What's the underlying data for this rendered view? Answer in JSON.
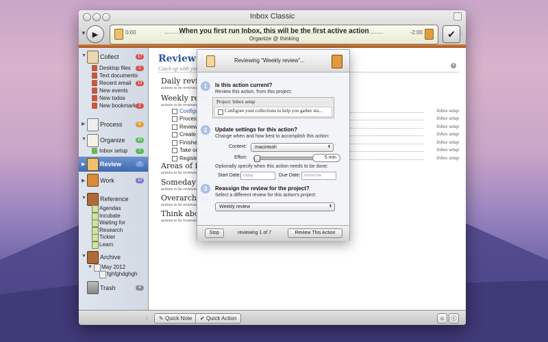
{
  "colors": {
    "accent": "#2f53a3",
    "wood": "#c06a2c",
    "selection": "#4a74bb",
    "badge_red": "#d9534f",
    "badge_green": "#5cb85c",
    "badge_gray": "#8c8c8c",
    "badge_orange": "#e39a3c",
    "badge_purple": "#7777c8"
  },
  "window": {
    "title": "Inbox Classic"
  },
  "toolbar": {
    "play_icon": "play-icon",
    "action_title": "When you first run Inbox, this will be the first active action",
    "action_context": "Organize @ thinking",
    "time_elapsed": "0:00",
    "time_remaining": "-2:00",
    "complete_icon": "checkmark-icon"
  },
  "sidebar": {
    "collect": {
      "label": "Collect",
      "badge": "17",
      "items": [
        {
          "label": "Desktop files",
          "badge": "2"
        },
        {
          "label": "Text documents",
          "badge": ""
        },
        {
          "label": "Recent email",
          "badge": "13"
        },
        {
          "label": "New events",
          "badge": ""
        },
        {
          "label": "New todos",
          "badge": ""
        },
        {
          "label": "New bookmarks",
          "badge": "2"
        }
      ]
    },
    "process": {
      "label": "Process",
      "badge": "6"
    },
    "organize": {
      "label": "Organize",
      "badge": "10",
      "items": [
        {
          "label": "Inbox setup",
          "badge": "7"
        }
      ]
    },
    "review": {
      "label": "Review",
      "badge": "7"
    },
    "work": {
      "label": "Work",
      "badge": "10"
    },
    "reference": {
      "label": "Reference",
      "items": [
        {
          "label": "Agendas"
        },
        {
          "label": "Incubate"
        },
        {
          "label": "Waiting for"
        },
        {
          "label": "Research"
        },
        {
          "label": "Tickler"
        },
        {
          "label": "Learn"
        }
      ]
    },
    "archive": {
      "label": "Archive",
      "month": "May 2012",
      "entry": "fghfghdghgh"
    },
    "trash": {
      "label": "Trash",
      "badge": "4"
    }
  },
  "main": {
    "title": "Review",
    "subtitle": "Catch up with your",
    "sections": [
      {
        "title": "Daily review",
        "sub": "actions to be reviewed"
      },
      {
        "title": "Weekly revie",
        "sub": "actions to be reviewed"
      },
      {
        "title": "Areas of foc",
        "sub": "actions to be reviewed"
      },
      {
        "title": "Someday ma",
        "sub": "actions to be reviewed"
      },
      {
        "title": "Overarching",
        "sub": "actions to be reviewed"
      },
      {
        "title": "Think about",
        "sub": "actions to be reviewed"
      }
    ],
    "weekly_actions": [
      {
        "text": "Configu",
        "context": "Inbox setup"
      },
      {
        "text": "Process",
        "context": "Inbox setup"
      },
      {
        "text": "Review",
        "context": "Inbox setup"
      },
      {
        "text": "Create s",
        "context": "Inbox setup"
      },
      {
        "text": "Finishe",
        "context": "Inbox setup"
      },
      {
        "text": "Take ou",
        "context": "Inbox setup"
      },
      {
        "text": "Register",
        "context": "Inbox setup"
      }
    ]
  },
  "review_panel": {
    "header": "Reviewing \"Weekly review\"...",
    "step1": {
      "num": "1",
      "title": "Is this action current?",
      "desc": "Review this action, from this project:",
      "project": "Project: Inbox setup",
      "action": "Configure your collections to help you gather stu..."
    },
    "step2": {
      "num": "2",
      "title": "Update settings for this action?",
      "desc": "Change when and how best to accomplish this action:",
      "context_label": "Context:",
      "context_value": "macintosh",
      "effort_label": "Effort:",
      "effort_value": "5 min",
      "effort_fraction": 0.0,
      "dates_desc": "Optionally specify when this action needs to be done:",
      "start_label": "Start Date:",
      "start_placeholder": "today",
      "due_label": "Due Date:",
      "due_placeholder": "tomorrow"
    },
    "step3": {
      "num": "3",
      "title": "Reassign the review for the project?",
      "desc": "Select a different review for this action's project:",
      "value": "Weekly review"
    },
    "stop_button": "Stop",
    "status": "reviewing 1 of 7",
    "review_button": "Review This Action"
  },
  "bottom": {
    "quick_note": "Quick Note",
    "quick_action": "Quick Action"
  }
}
